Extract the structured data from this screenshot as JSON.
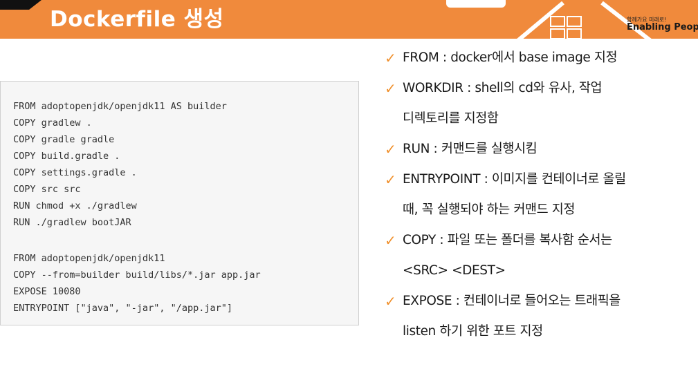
{
  "header": {
    "title": "Dockerfile 생성",
    "logo_tagline": "함께가요 미래로!",
    "logo_name": "Enabling Peop"
  },
  "code": {
    "lines": [
      "FROM adoptopenjdk/openjdk11 AS builder",
      "COPY gradlew .",
      "COPY gradle gradle",
      "COPY build.gradle .",
      "COPY settings.gradle .",
      "COPY src src",
      "RUN chmod +x ./gradlew",
      "RUN ./gradlew bootJAR",
      "",
      "FROM adoptopenjdk/openjdk11",
      "COPY --from=builder build/libs/*.jar app.jar",
      "EXPOSE 10080",
      "ENTRYPOINT [\"java\", \"-jar\", \"/app.jar\"]"
    ]
  },
  "bullets": {
    "check_icon": "checkmark-icon",
    "items": [
      "FROM : docker에서 base image 지정",
      "WORKDIR : shell의 cd와 유사, 작업",
      "디렉토리를 지정함",
      "RUN : 커맨드를 실행시킴",
      "ENTRYPOINT : 이미지를 컨테이너로 올릴",
      "때, 꼭 실행되야 하는 커맨드 지정",
      "COPY : 파일 또는 폴더를 복사함 순서는",
      "<SRC> <DEST>",
      "EXPOSE : 컨테이너로 들어오는 트래픽을",
      "listen 하기 위한 포트 지정"
    ]
  },
  "colors": {
    "header_orange": "#f08a3c",
    "check_orange": "#f0902c",
    "code_bg": "#f6f6f6"
  }
}
